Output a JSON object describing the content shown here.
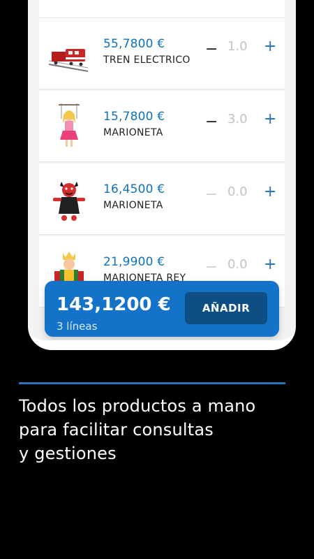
{
  "products": [
    {
      "price": "55,7800 €",
      "name": "TREN ELECTRICO",
      "qty": "1.0",
      "image": "train-toy-image"
    },
    {
      "price": "15,7800 €",
      "name": "MARIONETA",
      "qty": "3.0",
      "image": "puppet-girl-image"
    },
    {
      "price": "16,4500 €",
      "name": "MARIONETA",
      "qty": "0.0",
      "image": "puppet-devil-image"
    },
    {
      "price": "21,9900 €",
      "name": "MARIONETA REY",
      "qty": "0.0",
      "image": "puppet-king-image"
    }
  ],
  "controls": {
    "minus": "−",
    "plus": "+"
  },
  "summary": {
    "total": "143,1200 €",
    "lines": "3 líneas",
    "add_label": "AÑADIR"
  },
  "caption": {
    "line1": "Todos los productos a mano",
    "line2": "para facilitar consultas",
    "line3": "y gestiones"
  },
  "colors": {
    "accent": "#1473c9",
    "price": "#1272b8",
    "button": "#0e4e84"
  }
}
